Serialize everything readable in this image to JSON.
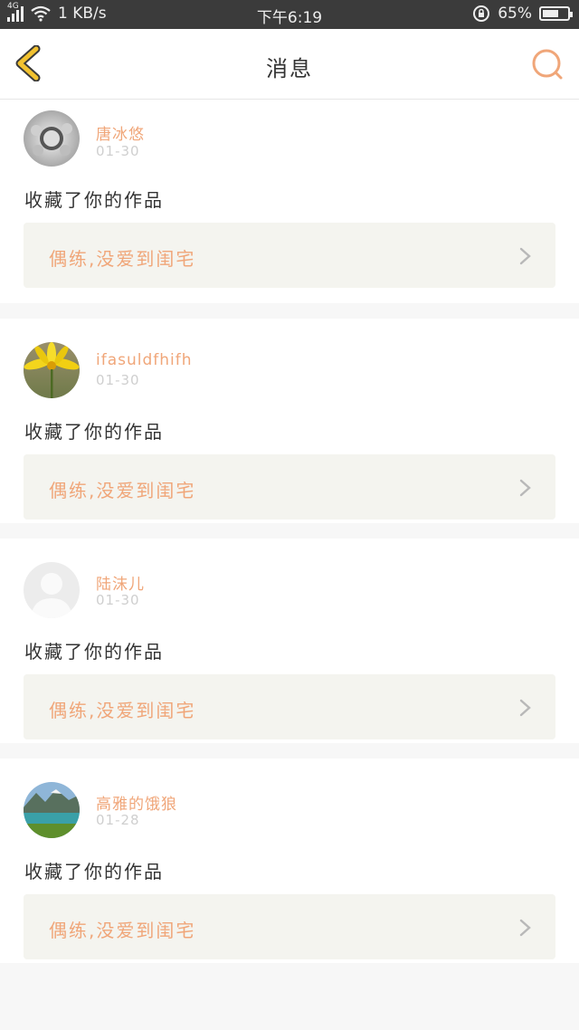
{
  "status_bar": {
    "network": "4G",
    "speed": "1 KB/s",
    "time": "下午6:19",
    "battery": "65%",
    "battery_level": 0.65
  },
  "header": {
    "title": "消息",
    "back_icon": "chevron-left-icon",
    "search_icon": "search-icon",
    "accent": "#f0a679",
    "back_color": "#f2c230"
  },
  "messages": [
    {
      "user": "唐冰悠",
      "date": "01-30",
      "action": "收藏了你的作品",
      "work_title": "偶练,没爱到闺宅",
      "avatar": "silver-ornament-avatar"
    },
    {
      "user": "ifasuldfhifh",
      "date": "01-30",
      "action": "收藏了你的作品",
      "work_title": "偶练,没爱到闺宅",
      "avatar": "yellow-flower-avatar"
    },
    {
      "user": "陆沫儿",
      "date": "01-30",
      "action": "收藏了你的作品",
      "work_title": "偶练,没爱到闺宅",
      "avatar": "default-avatar"
    },
    {
      "user": "高雅的饿狼",
      "date": "01-28",
      "action": "收藏了你的作品",
      "work_title": "偶练,没爱到闺宅",
      "avatar": "lake-landscape-avatar"
    }
  ]
}
